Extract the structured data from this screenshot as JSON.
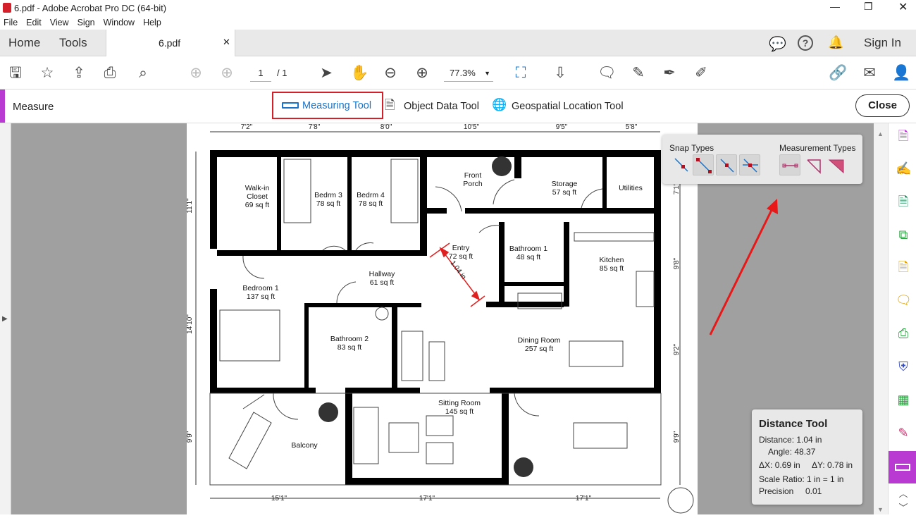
{
  "window": {
    "title": "6.pdf - Adobe Acrobat Pro DC (64-bit)"
  },
  "menu": [
    "File",
    "Edit",
    "View",
    "Sign",
    "Window",
    "Help"
  ],
  "tabs": {
    "home": "Home",
    "tools": "Tools",
    "doc": "6.pdf",
    "sign_in": "Sign In"
  },
  "toolbar": {
    "page_current": "1",
    "page_total": "/ 1",
    "zoom": "77.3%"
  },
  "measure": {
    "title": "Measure",
    "measuring_tool": "Measuring Tool",
    "object_data_tool": "Object Data Tool",
    "geospatial_tool": "Geospatial Location Tool",
    "close": "Close",
    "accent": "#d4202a"
  },
  "snap_panel": {
    "snap_types": "Snap Types",
    "measurement_types": "Measurement Types"
  },
  "distance_panel": {
    "title": "Distance Tool",
    "distance": "Distance: 1.04 in",
    "angle": "Angle: 48.37",
    "dx": "ΔX: 0.69 in",
    "dy": "ΔY: 0.78 in",
    "scale": "Scale Ratio: 1 in = 1 in",
    "precision_label": "Precision",
    "precision": "0.01"
  },
  "plan": {
    "top_dims": [
      "7'2\"",
      "7'8\"",
      "8'0\"",
      "10'5\"",
      "9'5\"",
      "5'8\""
    ],
    "bottom_dims": [
      "15'1\"",
      "17'1\"",
      "17'1\""
    ],
    "left_dims": [
      "11'1\"",
      "14'10\"",
      "9'9\""
    ],
    "right_dims": [
      "7'1\"",
      "9'8\"",
      "9'2\"",
      "9'9\""
    ],
    "rooms": {
      "closet": [
        "Walk-in",
        "Closet",
        "69 sq ft"
      ],
      "bed3": [
        "Bedrm 3",
        "78 sq ft"
      ],
      "bed4": [
        "Bedrm 4",
        "78 sq ft"
      ],
      "porch": [
        "Front",
        "Porch"
      ],
      "storage": [
        "Storage",
        "57 sq ft"
      ],
      "utilities": [
        "Utilities"
      ],
      "entry": [
        "Entry",
        "72 sq ft"
      ],
      "bath1": [
        "Bathroom 1",
        "48 sq ft"
      ],
      "kitchen": [
        "Kitchen",
        "85 sq ft"
      ],
      "hallway": [
        "Hallway",
        "61 sq ft"
      ],
      "bed1": [
        "Bedroom 1",
        "137 sq ft"
      ],
      "bath2": [
        "Bathroom 2",
        "83 sq ft"
      ],
      "dining": [
        "Dining Room",
        "257 sq ft"
      ],
      "sitting": [
        "Sitting Room",
        "145 sq ft"
      ],
      "balcony": [
        "Balcony"
      ]
    },
    "measurement_label": "1.04 in"
  }
}
